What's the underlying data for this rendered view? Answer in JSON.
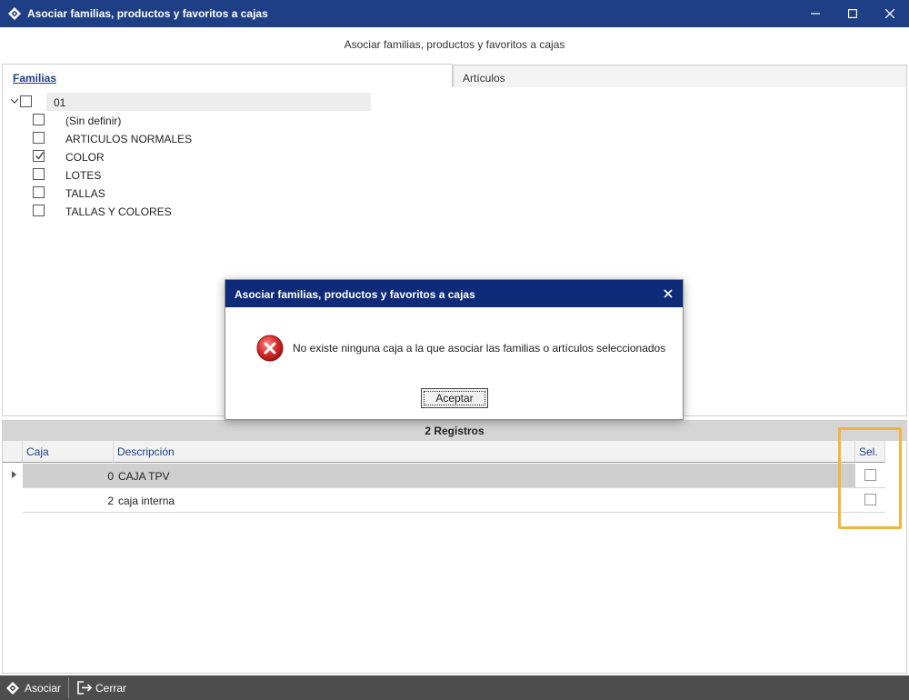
{
  "window": {
    "title": "Asociar familias, productos y favoritos a cajas",
    "subtitle": "Asociar familias, productos y favoritos a cajas",
    "controls": [
      "minimize",
      "maximize",
      "close"
    ]
  },
  "tabs": [
    {
      "label": "Familias",
      "active": true
    },
    {
      "label": "Artículos",
      "active": false
    }
  ],
  "tree": {
    "root": {
      "label": "01",
      "expanded": true,
      "checked": false
    },
    "items": [
      {
        "label": "(Sin definir)",
        "checked": false
      },
      {
        "label": "ARTICULOS NORMALES",
        "checked": false
      },
      {
        "label": "COLOR",
        "checked": true
      },
      {
        "label": "LOTES",
        "checked": false
      },
      {
        "label": "TALLAS",
        "checked": false
      },
      {
        "label": "TALLAS Y COLORES",
        "checked": false
      }
    ]
  },
  "grid": {
    "header": "2 Registros",
    "columns": {
      "caja": "Caja",
      "descripcion": "Descripción",
      "sel": "Sel."
    },
    "rows": [
      {
        "caja": "0",
        "descripcion": "CAJA TPV",
        "sel": false,
        "current": true
      },
      {
        "caja": "2",
        "descripcion": "caja interna",
        "sel": false,
        "current": false
      }
    ]
  },
  "footer": {
    "asociar_label": "Asociar",
    "cerrar_label": "Cerrar"
  },
  "dialog": {
    "title": "Asociar familias, productos y favoritos a cajas",
    "message": "No existe ninguna caja a la que asociar las familias o artículos seleccionados",
    "button_label": "Aceptar",
    "icon": "error-icon"
  },
  "colors": {
    "titlebar": "#1e3f85",
    "dialog_titlebar": "#0d2b78",
    "footer": "#4d4d4d",
    "highlight": "#f2b53c",
    "error": "#d92b2b"
  }
}
